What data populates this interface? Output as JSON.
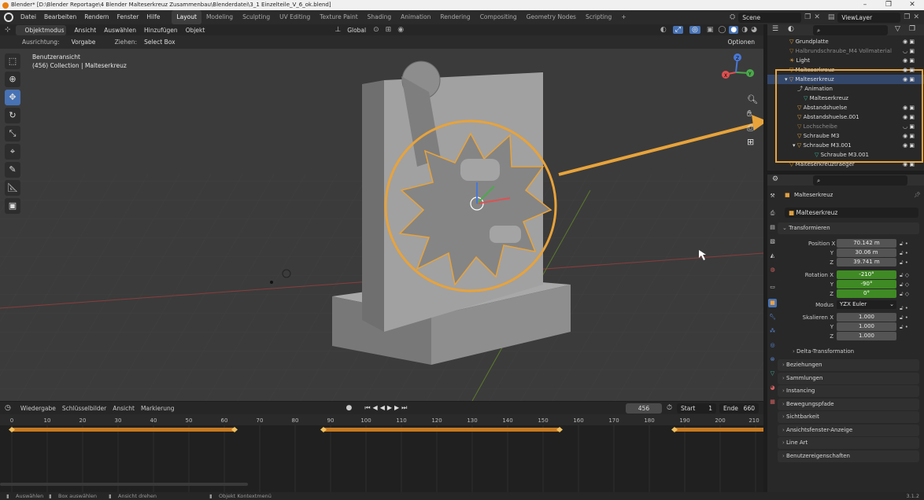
{
  "window": {
    "title": "Blender* [D:\\Blender Reportage\\4 Blender Malteserkreuz Zusammenbau\\Blenderdatei\\3_1 Einzelteile_V_6_ok.blend]",
    "min": "–",
    "max": "❐",
    "close": "✕"
  },
  "menu": {
    "items": [
      "Datei",
      "Bearbeiten",
      "Rendern",
      "Fenster",
      "Hilfe"
    ],
    "workspaces": [
      "Layout",
      "Modeling",
      "Sculpting",
      "UV Editing",
      "Texture Paint",
      "Shading",
      "Animation",
      "Rendering",
      "Compositing",
      "Geometry Nodes",
      "Scripting"
    ],
    "add_workspace": "+",
    "active_workspace": "Layout",
    "scene": "Scene",
    "view_layer": "ViewLayer"
  },
  "viewport_header": {
    "mode": "Objektmodus",
    "menus": [
      "Ansicht",
      "Auswählen",
      "Hinzufügen",
      "Objekt"
    ],
    "orientation": "Global"
  },
  "tool_settings": {
    "ausrichtung_label": "Ausrichtung:",
    "ausrichtung_value": "Vorgabe",
    "ziehen_label": "Ziehen:",
    "ziehen_value": "Select Box",
    "options": "Optionen"
  },
  "viewport_info": {
    "view": "Benutzeransicht",
    "collection": "(456) Collection | Malteserkreuz"
  },
  "gizmo": {
    "x": "X",
    "y": "Y",
    "z": "Z"
  },
  "timeline": {
    "menus": [
      "Wiedergabe",
      "Schlüsselbilder",
      "Ansicht",
      "Markierung"
    ],
    "current_frame": "456",
    "start_label": "Start",
    "start": "1",
    "end_label": "Ende",
    "end": "660",
    "ticks": [
      "0",
      "10",
      "20",
      "30",
      "40",
      "50",
      "60",
      "70",
      "80",
      "90",
      "100",
      "110",
      "120",
      "130",
      "140",
      "150",
      "160",
      "170",
      "180",
      "190",
      "200",
      "210"
    ]
  },
  "statusbar": {
    "items": [
      "Auswählen",
      "Box auswählen",
      "Ansicht drehen",
      "Objekt Kontextmenü"
    ],
    "version": "3.1.2"
  },
  "outliner": {
    "rows": [
      {
        "label": "Grundplatte",
        "dim": false,
        "sel": false
      },
      {
        "label": "Halbrundschraube_M4 Vollmaterial",
        "dim": true,
        "sel": false
      },
      {
        "label": "Light",
        "dim": false,
        "sel": false
      },
      {
        "label": "Malteserkreuz",
        "dim": false,
        "sel": false
      },
      {
        "label": "Malteserkreuz",
        "dim": false,
        "sel": true
      },
      {
        "label": "Animation",
        "dim": false,
        "sel": false
      },
      {
        "label": "Malteserkreuz",
        "dim": false,
        "sel": false
      },
      {
        "label": "Abstandshuelse",
        "dim": false,
        "sel": false
      },
      {
        "label": "Abstandshuelse.001",
        "dim": false,
        "sel": false
      },
      {
        "label": "Lochscheibe",
        "dim": true,
        "sel": false
      },
      {
        "label": "Schraube M3",
        "dim": false,
        "sel": false
      },
      {
        "label": "Schraube M3.001",
        "dim": false,
        "sel": false
      },
      {
        "label": "Schraube M3.001",
        "dim": false,
        "sel": false
      },
      {
        "label": "Malteserkreuztraeger",
        "dim": false,
        "sel": false
      }
    ]
  },
  "properties": {
    "object_name": "Malteserkreuz",
    "data_name": "Malteserkreuz",
    "transform_label": "Transformieren",
    "position": {
      "label": "Position X",
      "x": "70.142 m",
      "y": "30.06 m",
      "z": "39.741 m"
    },
    "rotation": {
      "label": "Rotation X",
      "x": "-210°",
      "y": "-90°",
      "z": "0°"
    },
    "mode_label": "Modus",
    "mode_value": "YZX Euler",
    "scale": {
      "label": "Skalieren X",
      "x": "1.000",
      "y": "1.000",
      "z": "1.000"
    },
    "axis_y": "Y",
    "axis_z": "Z",
    "delta": "Delta-Transformation",
    "panels": [
      "Beziehungen",
      "Sammlungen",
      "Instancing",
      "Bewegungspfade",
      "Sichtbarkeit",
      "Ansichtsfenster-Anzeige",
      "Line Art",
      "Benutzereigenschaften"
    ]
  },
  "colors": {
    "accent_orange": "#e8a33a",
    "selection_blue": "#4772b3",
    "animated_green": "#3f8a24"
  }
}
